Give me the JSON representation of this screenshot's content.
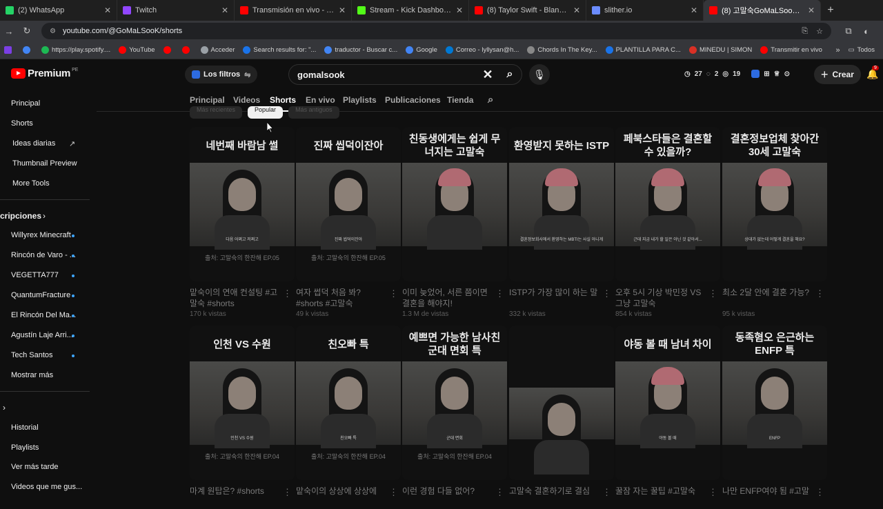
{
  "browser": {
    "tabs": [
      {
        "title": "(2) WhatsApp",
        "color": "#25d366"
      },
      {
        "title": "Twitch",
        "color": "#9146ff"
      },
      {
        "title": "Transmisión en vivo - YouTube",
        "color": "#ff0000"
      },
      {
        "title": "Stream - Kick Dashboard",
        "color": "#53fc18"
      },
      {
        "title": "(8) Taylor Swift - Blank Space -",
        "color": "#ff0000"
      },
      {
        "title": "slither.io",
        "color": "#6b8cff"
      },
      {
        "title": "(8) 고말숙GoMaLSooK - YouTu",
        "color": "#ff0000"
      }
    ],
    "url": "youtube.com/@GoMaLSooK/shorts",
    "bookmarks": [
      {
        "label": "https://play.spotify....",
        "color": "#1db954"
      },
      {
        "label": "YouTube",
        "color": "#ff0000"
      },
      {
        "label": "",
        "color": "#ff0000"
      },
      {
        "label": "",
        "color": "#ff0000"
      },
      {
        "label": "Acceder",
        "color": "#9aa0a6"
      },
      {
        "label": "Search results for: \"...",
        "color": "#1a73e8"
      },
      {
        "label": "traductor - Buscar c...",
        "color": "#4285f4"
      },
      {
        "label": "Google",
        "color": "#4285f4"
      },
      {
        "label": "Correo - lyllysan@h...",
        "color": "#0078d4"
      },
      {
        "label": "Chords In The Key...",
        "color": "#888888"
      },
      {
        "label": "PLANTILLA PARA C...",
        "color": "#1a73e8"
      },
      {
        "label": "MINEDU | SIMON",
        "color": "#d93025"
      },
      {
        "label": "Transmitir en vivo",
        "color": "#ff0000"
      }
    ],
    "bookmarks_more": "»",
    "bookmarks_folder": "Todos"
  },
  "header": {
    "logo": "Premium",
    "logo_region": "PE",
    "filter_label": "Los filtros",
    "search_value": "gomalsook",
    "stats": [
      "27",
      "2",
      "19"
    ],
    "create_label": "Crear",
    "notif_count": "9"
  },
  "sidebar": {
    "top": [
      "Principal",
      "Shorts",
      "Ideas diarias",
      "Thumbnail Preview",
      "More Tools"
    ],
    "subs_heading": "cripciones",
    "subs": [
      "Willyrex Minecraft",
      "Rincón de Varo - ...",
      "VEGETTA777",
      "QuantumFracture",
      "El Rincón Del Ma...",
      "Agustín Laje Arri...",
      "Tech Santos"
    ],
    "show_more": "Mostrar más",
    "you": [
      "Historial",
      "Playlists",
      "Ver más tarde",
      "Videos que me gus..."
    ]
  },
  "channel_tabs": [
    "Principal",
    "Videos",
    "Shorts",
    "En vivo",
    "Playlists",
    "Publicaciones",
    "Tienda"
  ],
  "chips": [
    "Más recientes",
    "Popular",
    "Más antiguos"
  ],
  "shorts": [
    {
      "overlay": "네번째 바람남 썰",
      "title": "맡숙이의 연애 컨설팅 #고말숙 #shorts",
      "views": "170 k vistas",
      "source": "출처: 고말숙의 한잔해 EP.05",
      "caption": "다음 어쩌고 저쩌고",
      "hat": false
    },
    {
      "overlay": "진짜 씹덕이잔아",
      "title": "여자 썹덕 처음 봐? #shorts #고말숙",
      "views": "49 k vistas",
      "source": "출처: 고말숙의 한잔해 EP.05",
      "caption": "진짜 씹덕이잔아",
      "hat": false
    },
    {
      "overlay": "친동생에게는 쉽게 무너지는 고말숙",
      "title": "이미 늦었어, 서른 쯤이면 결혼을 해야지!",
      "views": "1.3 M de vistas",
      "source": "",
      "caption": "",
      "hat": true
    },
    {
      "overlay": "환영받지 못하는 ISTP",
      "title": "ISTP가 가장 많이 하는 말",
      "views": "332 k vistas",
      "source": "",
      "caption": "결혼정보회사에서 환영하는 MBTI는 사실 아니게",
      "hat": true
    },
    {
      "overlay": "페북스타들은 결혼할 수 있을까?",
      "title": "오후 5시 기상 박민정 VS 그냥 고말숙",
      "views": "854 k vistas",
      "source": "",
      "caption": "근데 지금 내가 할 일은 아닌 것 같아서...",
      "hat": true
    },
    {
      "overlay": "결혼정보업체 찾아간 30세 고말숙",
      "title": "최소 2달 안에 결혼 가능?",
      "views": "95 k vistas",
      "source": "",
      "caption": "상대가 없는데 어떻게 결혼을 해요?",
      "hat": true
    },
    {
      "overlay": "인천 VS 수원",
      "title": "마계 원탑은? #shorts",
      "views": "",
      "source": "출처: 고말숙의 한잔해 EP.04",
      "caption": "인천 VS 수원",
      "hat": false
    },
    {
      "overlay": "친오빠 특",
      "title": "맡숙이의 상상에 상상에",
      "views": "",
      "source": "출처: 고말숙의 한잔해 EP.04",
      "caption": "친오빠 특",
      "hat": false
    },
    {
      "overlay": "예쁘면 가능한 남사친 군대 면회 특",
      "title": "이런 경험 다들 없어?",
      "views": "",
      "source": "출처: 고말숙의 한잔해 EP.04",
      "caption": "군대 면회",
      "hat": false
    },
    {
      "overlay": "",
      "title": "고말숙 결혼하기로 결심",
      "views": "",
      "source": "",
      "caption": "",
      "hat": false
    },
    {
      "overlay": "야동 볼 때 남녀 차이",
      "title": "꿀잠 자는 꿀팁 #고말숙",
      "views": "",
      "source": "",
      "caption": "야동 볼 때",
      "hat": true
    },
    {
      "overlay": "동족혐오 은근하는 ENFP 특",
      "title": "나만 ENFP여야 됨 #고말",
      "views": "",
      "source": "",
      "caption": "ENFP",
      "hat": false
    }
  ]
}
